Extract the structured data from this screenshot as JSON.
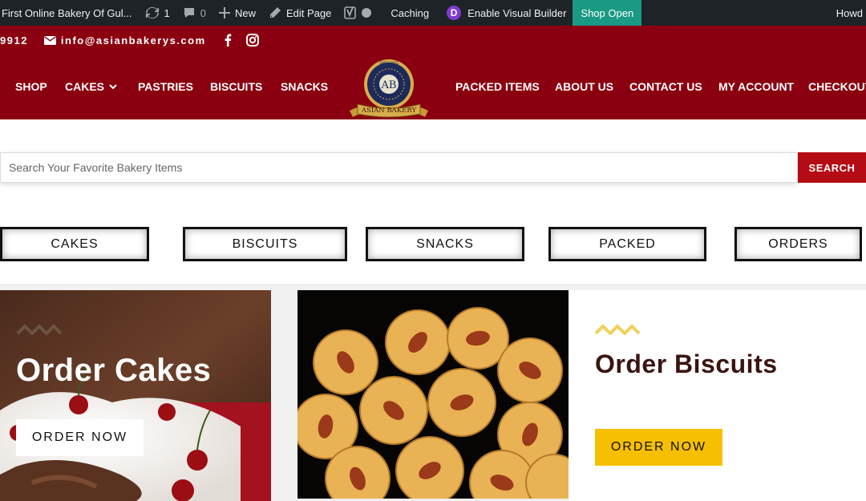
{
  "admin_bar": {
    "site_name": "- First Online Bakery Of Gul...",
    "updates_count": "1",
    "comments_count": "0",
    "new_label": "New",
    "edit_page_label": "Edit Page",
    "caching_label": "Caching",
    "visual_builder_label": "Enable Visual Builder",
    "shop_open_label": "Shop Open",
    "howdy_label": "Howd",
    "colors": {
      "bar": "#1d2327",
      "shop_open": "#1a9a84",
      "divi": "#7e3bd0"
    }
  },
  "topbar": {
    "phone": "9912",
    "email": "info@asianbakerys.com",
    "icons": [
      "mail-icon",
      "facebook-icon",
      "instagram-icon"
    ]
  },
  "nav": {
    "items_left": [
      {
        "label": "SHOP"
      },
      {
        "label": "CAKES"
      },
      {
        "label": "PASTRIES"
      },
      {
        "label": "BISCUITS"
      },
      {
        "label": "SNACKS"
      }
    ],
    "items_right": [
      {
        "label": "PACKED ITEMS"
      },
      {
        "label": "ABOUT US"
      },
      {
        "label": "CONTACT US"
      },
      {
        "label": "MY ACCOUNT"
      },
      {
        "label": "CHECKOUT"
      }
    ],
    "logo_text": "ASIAN BAKERY",
    "logo_monogram": "AB",
    "logo_since": "SINCE 1975",
    "brand_color": "#8b0010"
  },
  "search": {
    "placeholder": "Search Your Favorite Bakery Items",
    "button_label": "SEARCH",
    "button_color": "#b50b14"
  },
  "categories": [
    {
      "label": "CAKES"
    },
    {
      "label": "BISCUITS"
    },
    {
      "label": "SNACKS"
    },
    {
      "label": "PACKED"
    },
    {
      "label": "ORDERS"
    }
  ],
  "promos": {
    "cakes": {
      "title": "Order Cakes",
      "button_label": "ORDER NOW"
    },
    "biscuits": {
      "title": "Order Biscuits",
      "button_label": "ORDER NOW",
      "title_color": "#3a1510",
      "button_color": "#f6c000"
    }
  }
}
